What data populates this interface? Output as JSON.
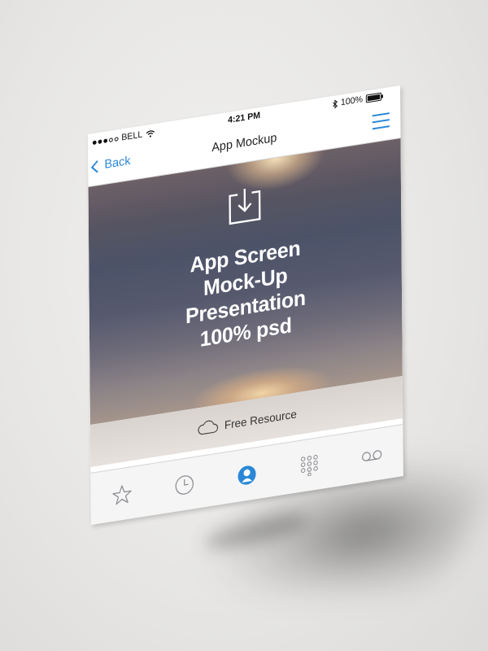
{
  "status_bar": {
    "carrier": "BELL",
    "time": "4:21 PM",
    "battery": "100%"
  },
  "nav": {
    "back_label": "Back",
    "title": "App Mockup"
  },
  "hero": {
    "title_lines": [
      "App Screen",
      "Mock-Up",
      "Presentation",
      "100% psd"
    ]
  },
  "resource": {
    "label": "Free Resource"
  },
  "tabs": [
    {
      "name": "favorites",
      "icon": "star-icon",
      "active": false
    },
    {
      "name": "recents",
      "icon": "clock-icon",
      "active": false
    },
    {
      "name": "contacts",
      "icon": "person-icon",
      "active": true
    },
    {
      "name": "keypad",
      "icon": "keypad-icon",
      "active": false
    },
    {
      "name": "voicemail",
      "icon": "voicemail-icon",
      "active": false
    }
  ],
  "colors": {
    "accent": "#2a87d8",
    "inactive_icon": "#8e8e93"
  }
}
